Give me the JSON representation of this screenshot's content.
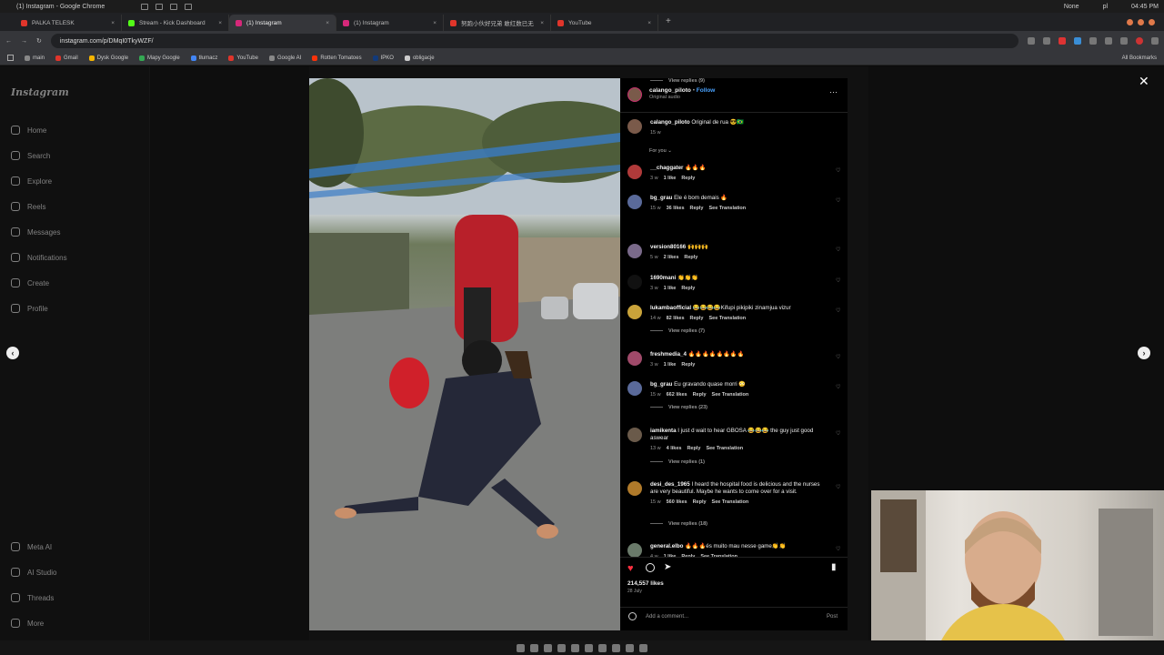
{
  "system": {
    "window_title": "(1) Instagram - Google Chrome",
    "indicators": [
      "None",
      "pl"
    ],
    "clock": "04:45 PM"
  },
  "tabs": [
    {
      "label": "PALKA TELESK",
      "color": "#e0352b"
    },
    {
      "label": "Stream - Kick Dashboard",
      "color": "#53fc18"
    },
    {
      "label": "(1) Instagram",
      "color": "#d6287a",
      "active": true
    },
    {
      "label": "(1) Instagram",
      "color": "#d6287a"
    },
    {
      "label": "努跑小伙好兄弟 敢红数已无",
      "color": "#e0352b"
    },
    {
      "label": "YouTube",
      "color": "#e0352b"
    }
  ],
  "url": "instagram.com/p/DMqI0TkyWZF/",
  "bookmarks": [
    {
      "label": "main",
      "color": "#888888"
    },
    {
      "label": "Gmail",
      "color": "#e0352b"
    },
    {
      "label": "Dysk Google",
      "color": "#f4b400"
    },
    {
      "label": "Mapy Google",
      "color": "#34a853"
    },
    {
      "label": "tłumacz",
      "color": "#4285f4"
    },
    {
      "label": "YouTube",
      "color": "#e0352b"
    },
    {
      "label": "Google AI",
      "color": "#888888"
    },
    {
      "label": "Rotten Tomatoes",
      "color": "#fa320a"
    },
    {
      "label": "IPKO",
      "color": "#123a7a"
    },
    {
      "label": "obligacje",
      "color": "#cccccc"
    }
  ],
  "all_bookmarks": "All Bookmarks",
  "instagram": {
    "logo": "Instagram",
    "nav": [
      "Home",
      "Search",
      "Explore",
      "Reels",
      "Messages",
      "Notifications",
      "Create",
      "Profile"
    ],
    "nav_bottom": [
      "Meta AI",
      "AI Studio",
      "Threads",
      "More"
    ]
  },
  "post": {
    "username": "calango_piloto",
    "follow": "Follow",
    "audio": "Original audio",
    "caption_user": "calango_piloto",
    "caption_text": "Original de rua 😎🇧🇷",
    "caption_time": "15 w",
    "sort": "For you",
    "likes": "214,557 likes",
    "date": "28 July",
    "add_comment": "Add a comment...",
    "post_btn": "Post"
  },
  "comments": [
    {
      "user": "__chaggater",
      "text": "🔥🔥🔥",
      "time": "3 w",
      "likes": "1 like",
      "reply": "Reply",
      "translate": "",
      "replies": "",
      "color": "#b03a3a"
    },
    {
      "user": "bg_grau",
      "text": "Ele é bom demais 🔥",
      "time": "15 w",
      "likes": "36 likes",
      "reply": "Reply",
      "translate": "See Translation",
      "replies": "View replies (9)",
      "color": "#5a6a9a"
    },
    {
      "user": "version80166",
      "text": "🙌🙌🙌",
      "time": "5 w",
      "likes": "2 likes",
      "reply": "Reply",
      "translate": "",
      "replies": "",
      "color": "#7a6a8a"
    },
    {
      "user": "1690mani",
      "text": "👏👏👏",
      "time": "3 w",
      "likes": "1 like",
      "reply": "Reply",
      "translate": "",
      "replies": "",
      "color": "#111111"
    },
    {
      "user": "lukambaofficial",
      "text": "😂😂😂😂Kifupi pikipiki zinamjua vizur",
      "time": "14 w",
      "likes": "82 likes",
      "reply": "Reply",
      "translate": "See Translation",
      "replies": "View replies (7)",
      "color": "#c9a33a"
    },
    {
      "user": "freshmedia_4",
      "text": "🔥🔥🔥🔥🔥🔥🔥🔥",
      "time": "3 w",
      "likes": "1 like",
      "reply": "Reply",
      "translate": "",
      "replies": "",
      "color": "#a04a6a"
    },
    {
      "user": "bg_grau",
      "text": "Eu gravando quase morri 😳",
      "time": "15 w",
      "likes": "662 likes",
      "reply": "Reply",
      "translate": "See Translation",
      "replies": "View replies (23)",
      "color": "#5a6a9a"
    },
    {
      "user": "iamikenta",
      "text": "I just d wait to hear GBOSA 😂😂😂 the guy just good aswear",
      "time": "13 w",
      "likes": "4 likes",
      "reply": "Reply",
      "translate": "See Translation",
      "replies": "View replies (1)",
      "color": "#6a5a4a"
    },
    {
      "user": "desi_des_1965",
      "text": "I heard the hospital food is delicious and the nurses are very beautiful. Maybe he wants to come over for a visit.",
      "time": "15 w",
      "likes": "560 likes",
      "reply": "Reply",
      "translate": "See Translation",
      "replies": "View replies (18)",
      "color": "#b07a2a"
    },
    {
      "user": "general.elbo",
      "text": "🔥🔥🔥és muito mau nesse game👏👏",
      "time": "4 w",
      "likes": "1 like",
      "reply": "Reply",
      "translate": "See Translation",
      "replies": "",
      "color": "#6a7a6a"
    }
  ]
}
